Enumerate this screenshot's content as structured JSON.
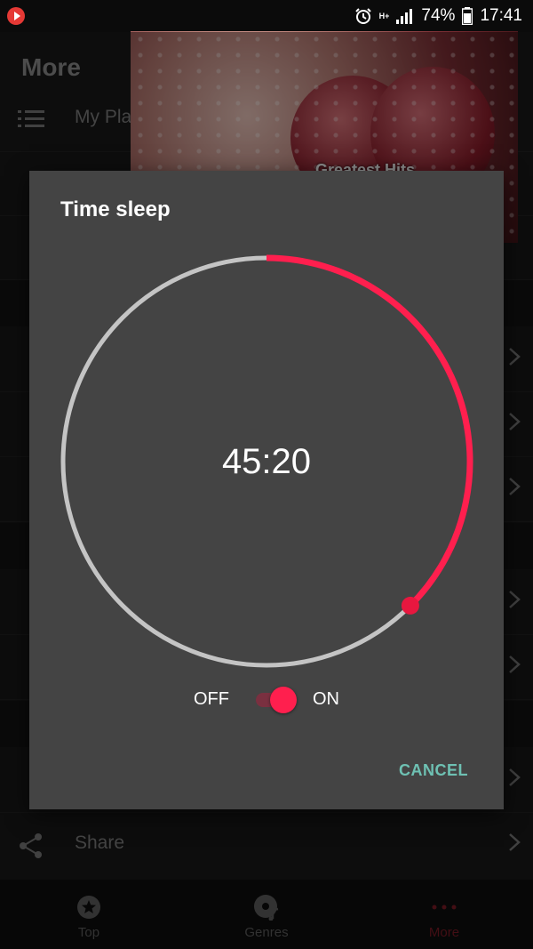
{
  "status_bar": {
    "battery": "74%",
    "time": "17:41",
    "network": "H+"
  },
  "background": {
    "page_title": "More",
    "first_item_label": "My Pla",
    "album_caption": "Greatest Hits",
    "share_label": "Share"
  },
  "bottom_nav": {
    "items": [
      {
        "label": "Top",
        "icon": "star-icon"
      },
      {
        "label": "Genres",
        "icon": "disc-icon"
      },
      {
        "label": "More",
        "icon": "more-dots-icon",
        "active": true
      }
    ]
  },
  "dialog": {
    "title": "Time sleep",
    "time_display": "45:20",
    "progress_fraction": 0.375,
    "switch_off_label": "OFF",
    "switch_on_label": "ON",
    "switch_state": "on",
    "cancel_label": "CANCEL"
  },
  "colors": {
    "accent": "#ff1f4e",
    "track": "#c4c4c4",
    "dialog_bg": "#444444",
    "cancel": "#6ec1b3"
  }
}
